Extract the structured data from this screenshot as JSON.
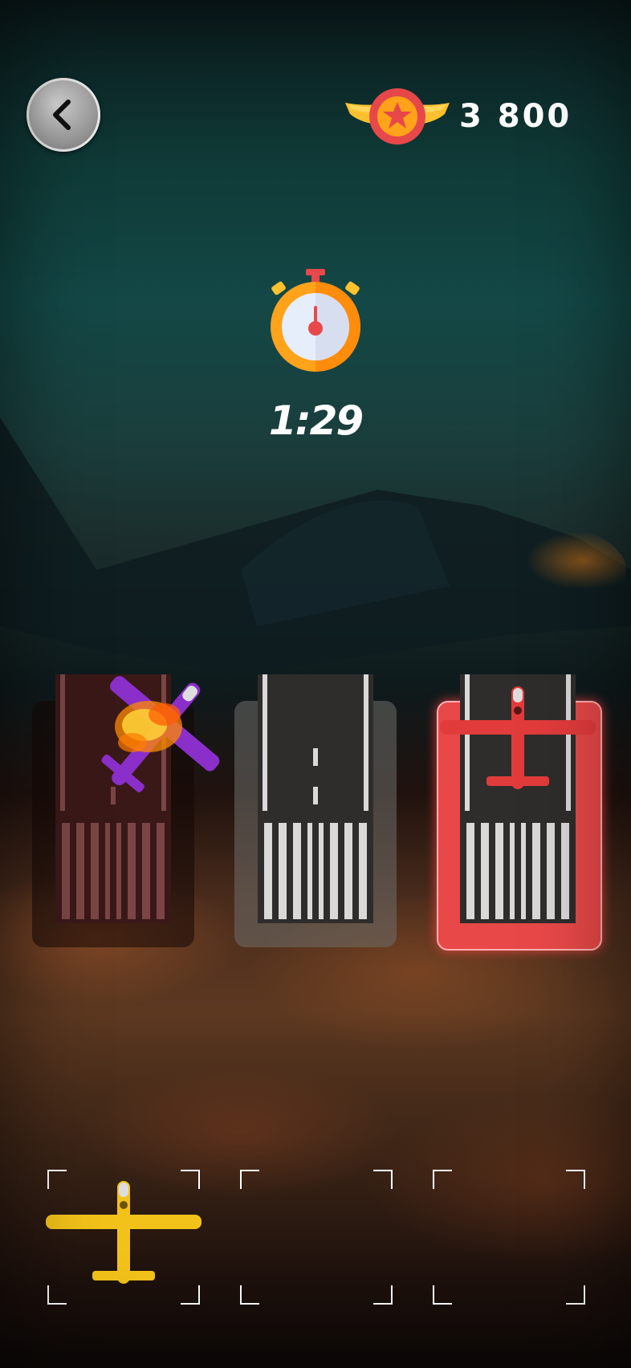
{
  "header": {
    "back_icon": "chevron-left-icon",
    "coin_icon": "winged-star-badge-icon",
    "coins": "3 800"
  },
  "timer": {
    "icon": "stopwatch-icon",
    "time": "1:29"
  },
  "runways": [
    {
      "state": "crashed",
      "plane_color": "#8a2fc9",
      "effect": "fire"
    },
    {
      "state": "empty"
    },
    {
      "state": "occupied",
      "plane_color": "#e23b3b",
      "highlight": "#e84848"
    }
  ],
  "slots": [
    {
      "state": "filled",
      "plane_color": "#f2c21a"
    },
    {
      "state": "empty"
    },
    {
      "state": "empty"
    }
  ],
  "colors": {
    "accent_red": "#e84848",
    "timer_orange": "#ffa31a",
    "badge_red": "#e8484a",
    "wing_yellow": "#ffc22e"
  }
}
